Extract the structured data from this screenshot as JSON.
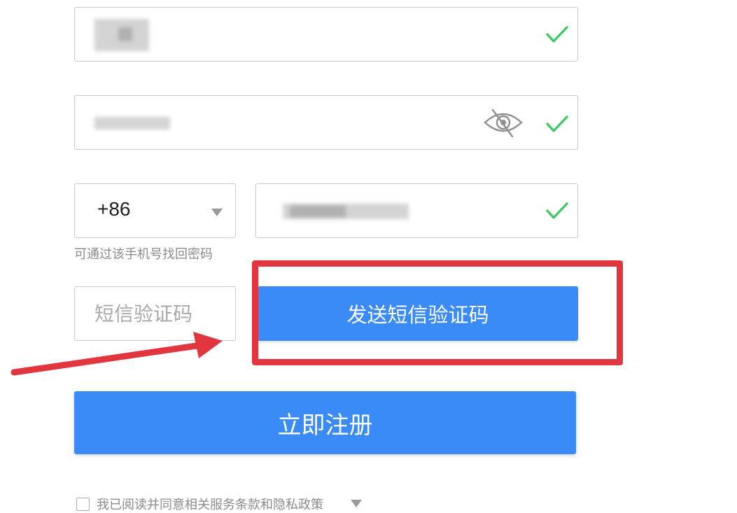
{
  "phone": {
    "country_code": "+86",
    "hint": "可通过该手机号找回密码"
  },
  "sms": {
    "placeholder": "短信验证码",
    "send_label": "发送短信验证码"
  },
  "register": {
    "label": "立即注册"
  },
  "agreement": {
    "text": "我已阅读并同意相关服务条款和隐私政策"
  },
  "icons": {
    "valid": "check-icon",
    "password_toggle": "eye-off-icon",
    "dropdown": "caret-down-icon"
  },
  "colors": {
    "primary": "#3a8bf7",
    "valid": "#3ec765",
    "annotation": "#e2363f"
  }
}
